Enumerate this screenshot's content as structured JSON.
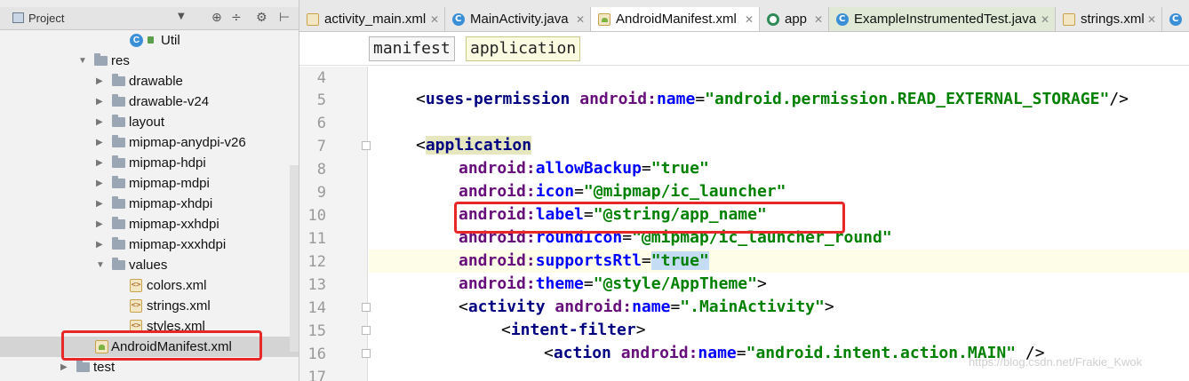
{
  "project_panel": {
    "title": "Project",
    "dropdown": "▼",
    "tools": [
      "⊕",
      "÷",
      "⚙",
      "⊢"
    ],
    "tree": [
      {
        "label": "Util",
        "kind": "class"
      },
      {
        "label": "res",
        "kind": "folder-open"
      },
      {
        "label": "drawable",
        "kind": "folder"
      },
      {
        "label": "drawable-v24",
        "kind": "folder"
      },
      {
        "label": "layout",
        "kind": "folder"
      },
      {
        "label": "mipmap-anydpi-v26",
        "kind": "folder"
      },
      {
        "label": "mipmap-hdpi",
        "kind": "folder"
      },
      {
        "label": "mipmap-mdpi",
        "kind": "folder"
      },
      {
        "label": "mipmap-xhdpi",
        "kind": "folder"
      },
      {
        "label": "mipmap-xxhdpi",
        "kind": "folder"
      },
      {
        "label": "mipmap-xxxhdpi",
        "kind": "folder"
      },
      {
        "label": "values",
        "kind": "folder-open"
      },
      {
        "label": "colors.xml",
        "kind": "xml"
      },
      {
        "label": "strings.xml",
        "kind": "xml"
      },
      {
        "label": "styles.xml",
        "kind": "xml"
      },
      {
        "label": "AndroidManifest.xml",
        "kind": "manifest"
      },
      {
        "label": "test",
        "kind": "folder"
      }
    ]
  },
  "tabs": [
    {
      "label": "activity_main.xml",
      "icon": "xml-file-icon",
      "active": false
    },
    {
      "label": "MainActivity.java",
      "icon": "class-icon",
      "active": false
    },
    {
      "label": "AndroidManifest.xml",
      "icon": "manifest-icon",
      "active": true
    },
    {
      "label": "app",
      "icon": "app-module-icon",
      "active": false
    },
    {
      "label": "ExampleInstrumentedTest.java",
      "icon": "class-icon",
      "active": false
    },
    {
      "label": "strings.xml",
      "icon": "xml-file-icon",
      "active": false
    }
  ],
  "breadcrumb": [
    "manifest",
    "application"
  ],
  "editor": {
    "line_numbers": [
      "4",
      "5",
      "6",
      "7",
      "8",
      "9",
      "10",
      "11",
      "12",
      "13",
      "14",
      "15",
      "16",
      "17"
    ],
    "current_line": "12",
    "code": {
      "l5_open": "<",
      "l5_tag": "uses-permission",
      "l5_ns": "android:",
      "l5_attr": "name",
      "l5_eq": "=",
      "l5_val": "\"android.permission.READ_EXTERNAL_STORAGE\"",
      "l5_end": "/>",
      "l7_open": "<",
      "l7_tag": "application",
      "l8_ns": "android:",
      "l8_attr": "allowBackup",
      "l8_eq": "=",
      "l8_val": "\"true\"",
      "l9_ns": "android:",
      "l9_attr": "icon",
      "l9_eq": "=",
      "l9_val": "\"@mipmap/ic_launcher\"",
      "l10_ns": "android:",
      "l10_attr": "label",
      "l10_eq": "=",
      "l10_val": "\"@string/app_name\"",
      "l11_ns": "android:",
      "l11_attr": "roundIcon",
      "l11_eq": "=",
      "l11_val": "\"@mipmap/ic_launcher_round\"",
      "l12_ns": "android:",
      "l12_attr": "supportsRtl",
      "l12_eq": "=",
      "l12_val": "\"true\"",
      "l13_ns": "android:",
      "l13_attr": "theme",
      "l13_eq": "=",
      "l13_val": "\"@style/AppTheme\"",
      "l13_end": ">",
      "l14_open": "<",
      "l14_tag": "activity",
      "l14_ns": "android:",
      "l14_attr": "name",
      "l14_eq": "=",
      "l14_val": "\".MainActivity\"",
      "l14_end": ">",
      "l15_open": "<",
      "l15_tag": "intent-filter",
      "l15_end": ">",
      "l16_open": "<",
      "l16_tag": "action",
      "l16_ns": "android:",
      "l16_attr": "name",
      "l16_eq": "=",
      "l16_val": "\"android.intent.action.MAIN\"",
      "l16_end": " />"
    }
  },
  "watermark": "https://blog.csdn.net/Frakie_Kwok",
  "colors": {
    "annotation": "#e82828",
    "tag": "#000080",
    "value": "#008000",
    "namespace": "#660e7a"
  }
}
